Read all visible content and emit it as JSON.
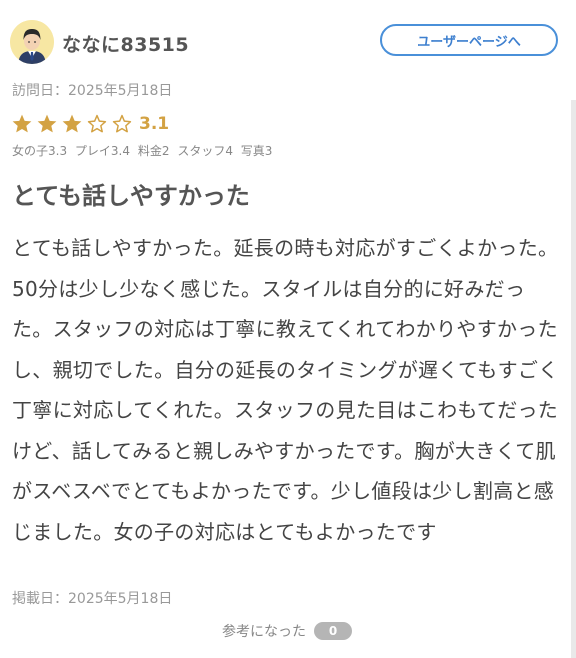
{
  "review": {
    "username": "ななに83515",
    "user_page_button": "ユーザーページへ",
    "visit_date": "訪問日：2025年5月18日",
    "rating": {
      "score": "3.1",
      "stars_filled": 3,
      "stars_total": 5,
      "star_color": "#d3a243"
    },
    "subscores": [
      "女の子3.3",
      "プレイ3.4",
      "料金2",
      "スタッフ4",
      "写真3"
    ],
    "title": "とても話しやすかった",
    "body": "とても話しやすかった。延長の時も対応がすごくよかった。50分は少し少なく感じた。スタイルは自分的に好みだった。スタッフの対応は丁寧に教えてくれてわかりやすかったし、親切でした。自分の延長のタイミングが遅くてもすごく丁寧に対応してくれた。スタッフの見た目はこわもてだったけど、話してみると親しみやすかったです。胸が大きくて肌がスベスベでとてもよかったです。少し値段は少し割高と感じました。女の子の対応はとてもよかったです",
    "posted_date": "掲載日：2025年5月18日",
    "helpful": {
      "label": "参考になった",
      "count": "0"
    }
  },
  "colors": {
    "accent_blue": "#4a90d9",
    "star_gold": "#d3a243",
    "avatar_bg": "#f7e7a3"
  }
}
